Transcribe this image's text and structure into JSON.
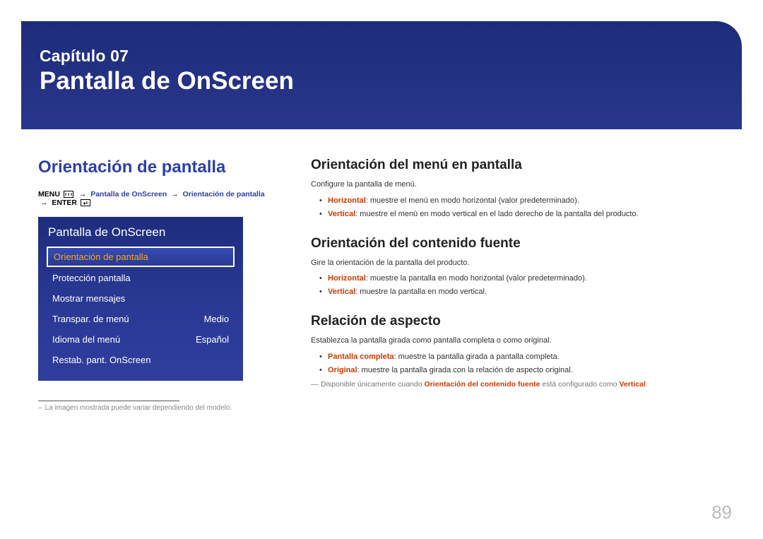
{
  "banner": {
    "chapter": "Capítulo 07",
    "title": "Pantalla de OnScreen"
  },
  "left": {
    "heading": "Orientación de pantalla",
    "breadcrumb": {
      "menu": "MENU",
      "p1": "Pantalla de OnScreen",
      "p2": "Orientación de pantalla",
      "enter": "ENTER"
    },
    "panel": {
      "title": "Pantalla de OnScreen",
      "items": [
        {
          "label": "Orientación de pantalla",
          "value": "",
          "selected": true
        },
        {
          "label": "Protección pantalla",
          "value": "",
          "selected": false
        },
        {
          "label": "Mostrar mensajes",
          "value": "",
          "selected": false
        },
        {
          "label": "Transpar. de menú",
          "value": "Medio",
          "selected": false
        },
        {
          "label": "Idioma del menú",
          "value": "Español",
          "selected": false
        },
        {
          "label": "Restab. pant. OnScreen",
          "value": "",
          "selected": false
        }
      ]
    },
    "footnote": "La imagen mostrada puede variar dependiendo del modelo."
  },
  "right": {
    "sections": [
      {
        "heading": "Orientación del menú en pantalla",
        "intro": "Configure la pantalla de menú.",
        "bullets": [
          {
            "term": "Horizontal",
            "rest": ": muestre el menú en modo horizontal (valor predeterminado)."
          },
          {
            "term": "Vertical",
            "rest": ": muestre el menú en modo vertical en el lado derecho de la pantalla del producto."
          }
        ]
      },
      {
        "heading": "Orientación del contenido fuente",
        "intro": "Gire la orientación de la pantalla del producto.",
        "bullets": [
          {
            "term": "Horizontal",
            "rest": ": muestre la pantalla en modo horizontal (valor predeterminado)."
          },
          {
            "term": "Vertical",
            "rest": ": muestre la pantalla en modo vertical."
          }
        ]
      },
      {
        "heading": "Relación de aspecto",
        "intro": "Establezca la pantalla girada como pantalla completa o como original.",
        "bullets": [
          {
            "term": "Pantalla completa",
            "rest": ": muestre la pantalla girada a pantalla completa."
          },
          {
            "term": "Original",
            "rest": ": muestre la pantalla girada con la relación de aspecto original."
          }
        ],
        "note": {
          "pre": "Disponible únicamente cuando ",
          "hl1": "Orientación del contenido fuente",
          "mid": " está configurado como ",
          "hl2": "Vertical",
          "post": "."
        }
      }
    ]
  },
  "page_number": "89"
}
